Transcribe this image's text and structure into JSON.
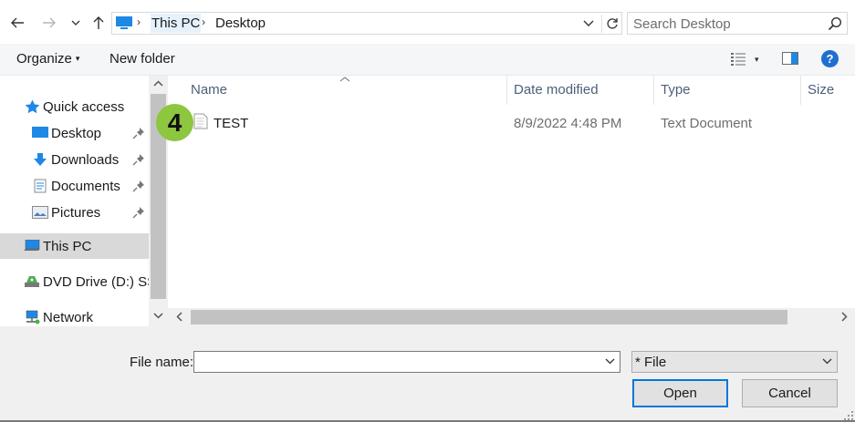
{
  "address": {
    "back_icon": "arrow-left-icon",
    "forward_icon": "arrow-right-icon",
    "recent_icon": "chevron-down-icon",
    "up_icon": "arrow-up-icon",
    "breadcrumbs": [
      "This PC",
      "Desktop"
    ],
    "refresh_icon": "refresh-icon"
  },
  "search": {
    "placeholder": "Search Desktop",
    "icon": "search-icon"
  },
  "toolbar": {
    "organize_label": "Organize",
    "new_folder_label": "New folder",
    "help_label": "?"
  },
  "nav": {
    "items": [
      {
        "label": "Quick access",
        "icon": "star-icon"
      },
      {
        "label": "Desktop",
        "icon": "desktop-icon",
        "pinned": true
      },
      {
        "label": "Downloads",
        "icon": "download-icon",
        "pinned": true
      },
      {
        "label": "Documents",
        "icon": "documents-icon",
        "pinned": true
      },
      {
        "label": "Pictures",
        "icon": "pictures-icon",
        "pinned": true
      },
      {
        "label": "This PC",
        "icon": "computer-icon",
        "selected": true
      },
      {
        "label": "DVD Drive (D:) SSS",
        "icon": "dvd-drive-icon"
      },
      {
        "label": "Network",
        "icon": "network-icon"
      }
    ]
  },
  "columns": {
    "name": "Name",
    "date_modified": "Date modified",
    "type": "Type",
    "size": "Size"
  },
  "files": [
    {
      "name": "TEST",
      "date_modified": "8/9/2022 4:48 PM",
      "type": "Text Document",
      "icon": "text-file-icon"
    }
  ],
  "step_badge": "4",
  "form": {
    "file_name_label": "File name:",
    "file_name_value": "",
    "file_type_selected": "* File",
    "open_label": "Open",
    "cancel_label": "Cancel"
  },
  "colors": {
    "accent": "#0078d7",
    "badge": "#8dc63f",
    "selected_nav": "#d9d9d9",
    "breadcrumb_highlight": "#e5f1fb"
  }
}
